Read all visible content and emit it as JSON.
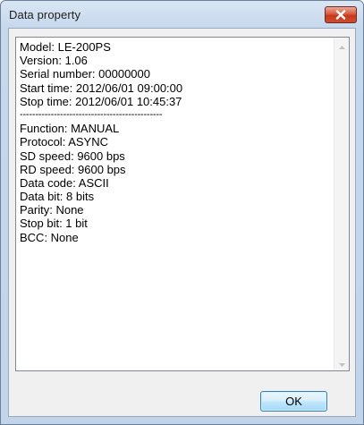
{
  "window": {
    "title": "Data property"
  },
  "content": {
    "lines": [
      "Model: LE-200PS",
      "Version: 1.06",
      "Serial number: 00000000",
      "Start time: 2012/06/01 09:00:00",
      "Stop time: 2012/06/01 10:45:37",
      "----------------------------------------------",
      "Function: MANUAL",
      "Protocol: ASYNC",
      "SD speed: 9600 bps",
      "RD speed: 9600 bps",
      "Data code: ASCII",
      "Data bit: 8 bits",
      "Parity: None",
      "Stop bit: 1 bit",
      "BCC: None"
    ]
  },
  "buttons": {
    "ok_label": "OK"
  },
  "icons": {
    "close": "close-icon",
    "scroll_up": "scroll-up-arrow-icon",
    "scroll_down": "scroll-down-arrow-icon"
  },
  "colors": {
    "close_button": "#d8593f",
    "ok_button_border": "#3c7fb1",
    "title_bar": "#c6d8ec"
  }
}
